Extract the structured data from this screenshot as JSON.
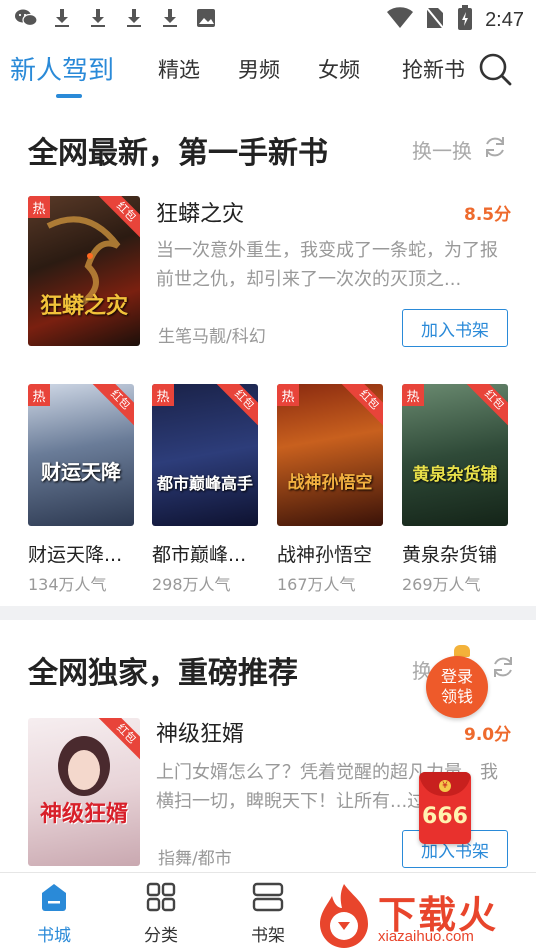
{
  "status_bar": {
    "time": "2:47"
  },
  "tabs": [
    {
      "label": "新人驾到",
      "active": true
    },
    {
      "label": "精选"
    },
    {
      "label": "男频"
    },
    {
      "label": "女频"
    },
    {
      "label": "抢新书"
    }
  ],
  "section1": {
    "title": "全网最新，第一手新书",
    "refresh_label": "换一换",
    "featured": {
      "title": "狂蟒之灾",
      "score": "8.5分",
      "description": "当一次意外重生，我变成了一条蛇，为了报前世之仇，却引来了一次次的灭顶之...",
      "meta": "生笔马靓/科幻",
      "add_label": "加入书架",
      "cover_text": "狂蟒之灾",
      "hot": "热",
      "ribbon": "红包"
    },
    "grid": [
      {
        "name": "财运天降...",
        "popularity": "134万人气",
        "cover_text": "财运天降",
        "hot": "热",
        "ribbon": "红包"
      },
      {
        "name": "都市巅峰...",
        "popularity": "298万人气",
        "cover_text": "都市巅峰高手",
        "hot": "热",
        "ribbon": "红包"
      },
      {
        "name": "战神孙悟空",
        "popularity": "167万人气",
        "cover_text": "战神孙悟空",
        "hot": "热",
        "ribbon": "红包"
      },
      {
        "name": "黄泉杂货铺",
        "popularity": "269万人气",
        "cover_text": "黄泉杂货铺",
        "hot": "热",
        "ribbon": "红包"
      }
    ]
  },
  "section2": {
    "title": "全网独家，重磅推荐",
    "refresh_label": "换",
    "featured": {
      "title": "神级狂婿",
      "score": "9.0分",
      "description": "上门女婿怎么了？凭着觉醒的超凡力量，我横扫一切，睥睨天下！让所有...过...",
      "meta": "指舞/都市",
      "add_label": "加入书架",
      "cover_text": "神级狂婿",
      "ribbon": "红包"
    }
  },
  "floating": {
    "login_line1": "登录",
    "login_line2": "领钱",
    "redpack_value": "666",
    "redpack_coin": "¥"
  },
  "bottom_nav": [
    {
      "label": "书城",
      "active": true
    },
    {
      "label": "分类"
    },
    {
      "label": "书架"
    }
  ],
  "watermark": {
    "text": "下载火",
    "url": "xiazaihuo.com"
  },
  "colors": {
    "accent": "#2a8ad8",
    "score": "#ee6a2d",
    "hot": "#e8443a"
  }
}
